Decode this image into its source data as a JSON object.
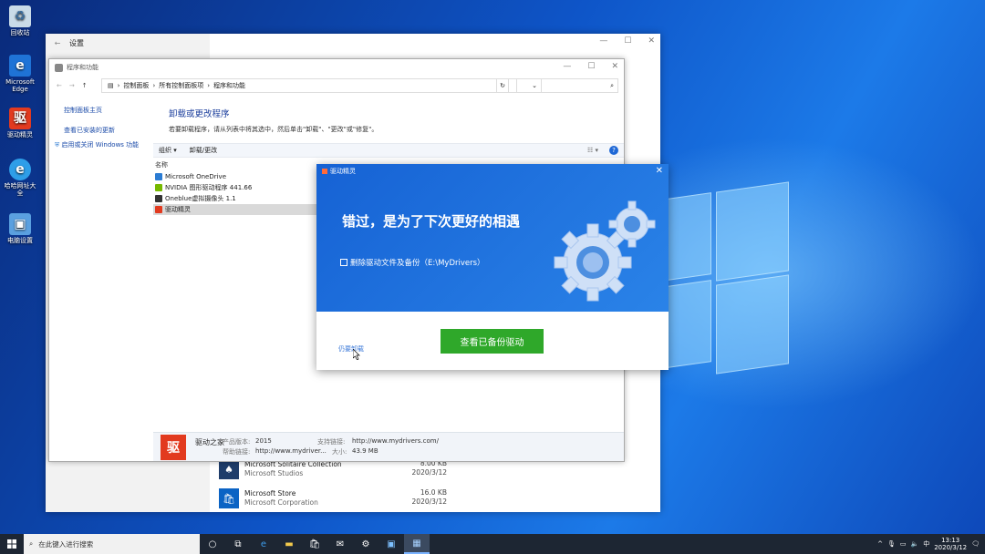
{
  "desktop": {
    "icons": [
      {
        "label": "回收站"
      },
      {
        "label": "Microsoft Edge"
      },
      {
        "label": "驱动精灵"
      },
      {
        "label": "哈哈网址大全"
      },
      {
        "label": "电脑设置"
      }
    ]
  },
  "settings": {
    "title": "设置",
    "apps": [
      {
        "name": "Microsoft Solitaire Collection",
        "publisher": "Microsoft Studios",
        "size": "8.00 KB",
        "date": "2020/3/12"
      },
      {
        "name": "Microsoft Store",
        "publisher": "Microsoft Corporation",
        "size": "16.0 KB",
        "date": "2020/3/12"
      }
    ]
  },
  "control_panel": {
    "title": "程序和功能",
    "breadcrumb": [
      "控制面板",
      "所有控制面板项",
      "程序和功能"
    ],
    "sidebar": [
      "控制面板主页",
      "查看已安装的更新",
      "启用或关闭 Windows 功能"
    ],
    "heading": "卸载或更改程序",
    "description": "若要卸载程序，请从列表中将其选中，然后单击\"卸载\"、\"更改\"或\"修复\"。",
    "toolbar": {
      "organize": "组织 ▾",
      "uninstall": "卸载/更改"
    },
    "column_name": "名称",
    "programs": [
      {
        "name": "Microsoft OneDrive",
        "color": "#2b7cd3"
      },
      {
        "name": "NVIDIA 图形驱动程序 441.66",
        "color": "#76b900"
      },
      {
        "name": "Oneblue虚拟摄像头 1.1",
        "color": "#333333"
      },
      {
        "name": "驱动精灵",
        "color": "#e23a1f"
      }
    ],
    "details": {
      "publisher": "驱动之家",
      "logo_char": "驱",
      "version_label": "产品版本:",
      "version": "2015",
      "support_label": "支持链接:",
      "support": "http://www.mydrivers.com/",
      "help_label": "帮助链接:",
      "help": "http://www.mydriver...",
      "size_label": "大小:",
      "size": "43.9 MB"
    }
  },
  "dialog": {
    "title": "驱动精灵",
    "headline": "错过，是为了下次更好的相遇",
    "checkbox_label": "删除驱动文件及备份（E:\\MyDrivers）",
    "button": "查看已备份驱动",
    "link": "仍要卸载"
  },
  "taskbar": {
    "search_placeholder": "在此键入进行搜索",
    "ime": "中",
    "time": "13:13",
    "date": "2020/3/12"
  }
}
